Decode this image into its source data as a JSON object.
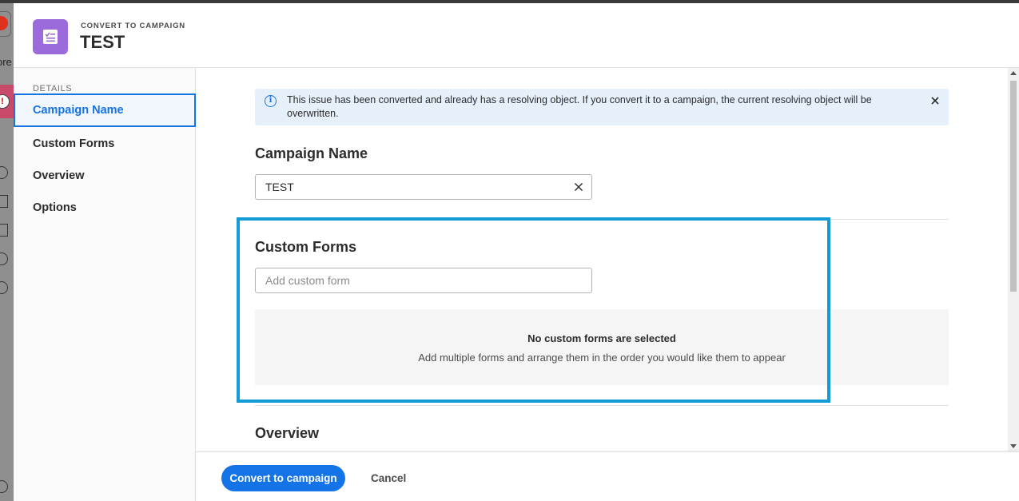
{
  "header": {
    "eyebrow": "CONVERT TO CAMPAIGN",
    "title": "TEST"
  },
  "sidebar": {
    "section_label": "DETAILS",
    "items": [
      {
        "label": "Campaign Name",
        "active": true
      },
      {
        "label": "Custom Forms",
        "active": false
      },
      {
        "label": "Overview",
        "active": false
      },
      {
        "label": "Options",
        "active": false
      }
    ]
  },
  "alert": {
    "text": "This issue has been converted and already has a resolving object. If you convert it to a campaign, the current resolving object will be overwritten."
  },
  "campaign_name": {
    "heading": "Campaign Name",
    "value": "TEST"
  },
  "custom_forms": {
    "heading": "Custom Forms",
    "placeholder": "Add custom form",
    "empty_title": "No custom forms are selected",
    "empty_subtitle": "Add multiple forms and arrange them in the order you would like them to appear"
  },
  "overview": {
    "heading": "Overview"
  },
  "footer": {
    "primary_label": "Convert to campaign",
    "cancel_label": "Cancel"
  },
  "background_app": {
    "partial_text": "ore"
  },
  "colors": {
    "accent": "#1473e6",
    "highlight_frame": "#149bd7",
    "app_icon": "#9b6bdc",
    "alert_bg": "#e6f0fb"
  }
}
